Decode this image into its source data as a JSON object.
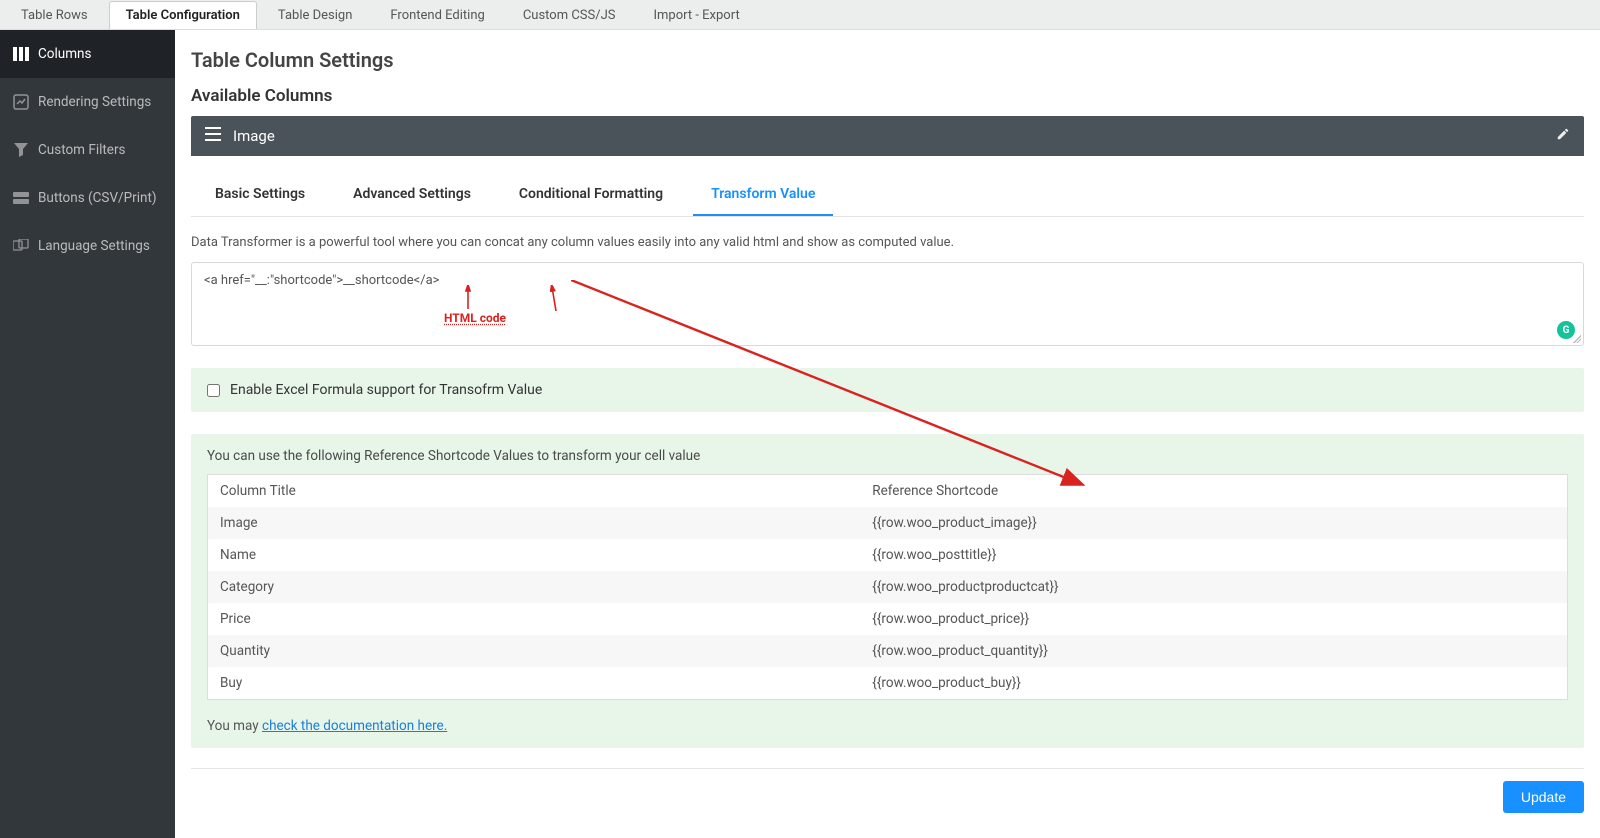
{
  "topTabs": [
    {
      "label": "Table Rows",
      "active": false
    },
    {
      "label": "Table Configuration",
      "active": true
    },
    {
      "label": "Table Design",
      "active": false
    },
    {
      "label": "Frontend Editing",
      "active": false
    },
    {
      "label": "Custom CSS/JS",
      "active": false
    },
    {
      "label": "Import - Export",
      "active": false
    }
  ],
  "sidebar": {
    "items": [
      {
        "label": "Columns",
        "icon": "columns-icon",
        "active": true
      },
      {
        "label": "Rendering Settings",
        "icon": "rendering-icon",
        "active": false
      },
      {
        "label": "Custom Filters",
        "icon": "filter-icon",
        "active": false
      },
      {
        "label": "Buttons (CSV/Print)",
        "icon": "buttons-icon",
        "active": false
      },
      {
        "label": "Language Settings",
        "icon": "language-icon",
        "active": false
      }
    ]
  },
  "page": {
    "title": "Table Column Settings",
    "section": "Available Columns"
  },
  "panel": {
    "title": "Image"
  },
  "subTabs": [
    {
      "label": "Basic Settings",
      "active": false
    },
    {
      "label": "Advanced Settings",
      "active": false
    },
    {
      "label": "Conditional Formatting",
      "active": false
    },
    {
      "label": "Transform Value",
      "active": true
    }
  ],
  "transform": {
    "description": "Data Transformer is a powerful tool where you can concat any column values easily into any valid html and show as computed value.",
    "value": "<a href=\"__:\"shortcode\">__shortcode</a>",
    "annotationLabel": "HTML code"
  },
  "excelCheckbox": {
    "checked": false,
    "label": "Enable Excel Formula support for Transofrm Value"
  },
  "reference": {
    "intro": "You can use the following Reference Shortcode Values to transform your cell value",
    "headers": {
      "col1": "Column Title",
      "col2": "Reference Shortcode"
    },
    "rows": [
      {
        "title": "Image",
        "code": "{{row.woo_product_image}}"
      },
      {
        "title": "Name",
        "code": "{{row.woo_posttitle}}"
      },
      {
        "title": "Category",
        "code": "{{row.woo_productproductcat}}"
      },
      {
        "title": "Price",
        "code": "{{row.woo_product_price}}"
      },
      {
        "title": "Quantity",
        "code": "{{row.woo_product_quantity}}"
      },
      {
        "title": "Buy",
        "code": "{{row.woo_product_buy}}"
      }
    ]
  },
  "docLine": {
    "prefix": "You may ",
    "linkText": "check the documentation here."
  },
  "footer": {
    "updateLabel": "Update"
  }
}
